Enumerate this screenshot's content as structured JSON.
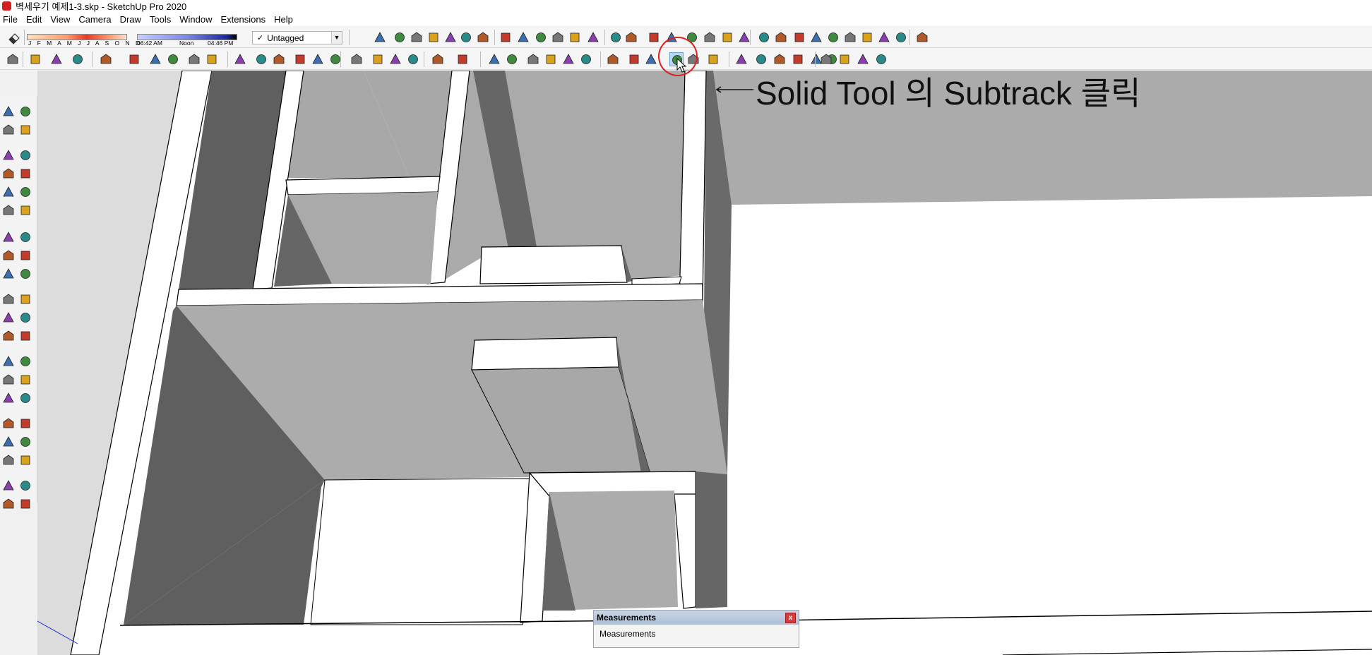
{
  "window": {
    "title": "벽세우기 예제1-3.skp - SketchUp Pro 2020"
  },
  "menu": [
    "File",
    "Edit",
    "View",
    "Camera",
    "Draw",
    "Tools",
    "Window",
    "Extensions",
    "Help"
  ],
  "shadows": {
    "months": "J F M A M J J A S O N D",
    "time_start": "06:42 AM",
    "time_mid": "Noon",
    "time_end": "04:46 PM"
  },
  "tag": {
    "selected": "Untagged",
    "check": "✓"
  },
  "annotation": {
    "text": "Solid Tool 의 Subtrack 클릭",
    "arrow": "←"
  },
  "measurements": {
    "title": "Measurements",
    "label": "Measurements",
    "close": "x"
  },
  "colors": {
    "annotation_circle": "#e02020",
    "wall_top": "#ffffff",
    "wall_light": "#acacac",
    "wall_dark": "#666666",
    "ground_dark": "#5e5e5e"
  },
  "icons": {
    "top_row": [
      "eraser-icon",
      "shadow-toggle-icon",
      "iso-view-icon",
      "top-view-icon",
      "front-view-icon",
      "right-view-icon",
      "back-view-icon",
      "left-view-icon",
      "xray-icon",
      "back-edges-icon",
      "wireframe-icon",
      "hidden-line-icon",
      "shaded-icon",
      "shaded-textures-icon",
      "monochrome-icon",
      "section-plane-icon",
      "section-display-icon",
      "section-cuts-icon",
      "push-pull-icon",
      "follow-me-icon",
      "offset-icon",
      "intersect-icon",
      "solid-icon",
      "orbit-icon",
      "pan-icon",
      "zoom-icon",
      "zoom-window-icon",
      "zoom-extents-icon",
      "position-camera-icon",
      "look-around-icon",
      "walk-icon",
      "geolocation-icon"
    ],
    "second_row": [
      "select-icon",
      "eraser-icon",
      "pencil-icon",
      "arc-icon",
      "rectangle-icon",
      "push-pull-icon",
      "follow-me-icon",
      "move-icon",
      "rotate-icon",
      "scale-icon",
      "tape-icon",
      "text-icon",
      "paint-icon",
      "orbit-icon",
      "pan-icon",
      "zoom-icon",
      "zoom-extents-icon",
      "3d-warehouse-icon",
      "extension-warehouse-icon",
      "layout-icon",
      "ruby-icon",
      "user-icon",
      "warehouse-icon",
      "house-icon",
      "house-outline-icon",
      "house-roof-icon",
      "house-door-icon",
      "storefront-icon",
      "outer-shell-icon",
      "intersect-solid-icon",
      "union-icon",
      "subtract-icon",
      "trim-icon",
      "split-icon",
      "sandbox-icon",
      "from-contours-icon",
      "from-scratch-icon",
      "smoove-icon",
      "stamp-icon",
      "drape-icon",
      "axes-icon",
      "iso-cube-icon",
      "front-cube-icon",
      "top-cube-icon"
    ]
  }
}
